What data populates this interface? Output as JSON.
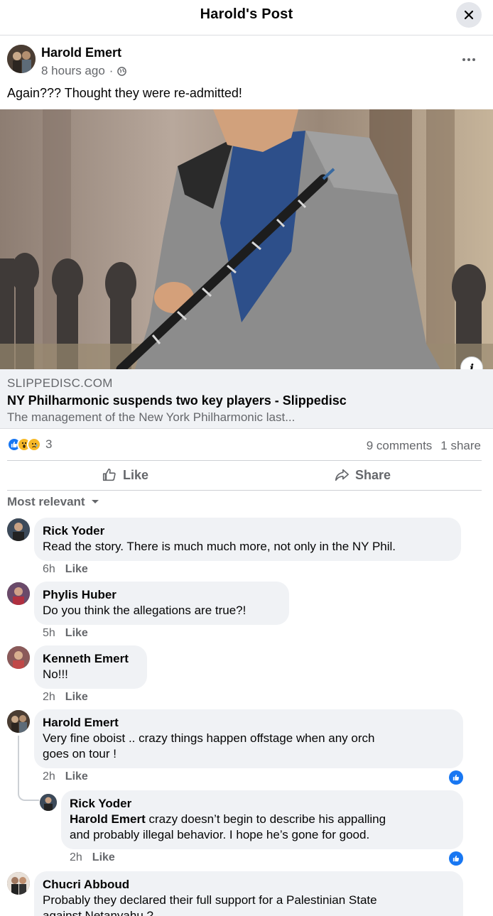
{
  "header": {
    "title": "Harold's Post"
  },
  "post": {
    "author": "Harold Emert",
    "time": "8 hours ago",
    "time_separator": "·",
    "text": "Again??? Thought they were re-admitted!"
  },
  "link_preview": {
    "domain": "SLIPPEDISC.COM",
    "title": "NY Philharmonic suspends two key players - Slippedisc",
    "description": "The management of the New York Philharmonic last..."
  },
  "reactions": {
    "count": "3",
    "types": [
      "like",
      "wow",
      "sad"
    ]
  },
  "stats": {
    "comments": "9 comments",
    "shares": "1 share"
  },
  "actions": {
    "like": "Like",
    "share": "Share"
  },
  "sort": {
    "label": "Most relevant"
  },
  "comments": [
    {
      "name": "Rick Yoder",
      "text": "Read the story. There is much much more, not only in the NY Phil.",
      "time": "6h",
      "like": "Like"
    },
    {
      "name": "Phylis Huber",
      "text": "Do you think the allegations are true?!",
      "time": "5h",
      "like": "Like"
    },
    {
      "name": "Kenneth Emert",
      "text": "No!!!",
      "time": "2h",
      "like": "Like"
    },
    {
      "name": "Harold Emert",
      "text_line1": "Very fine oboist .. crazy things happen offstage when any orch",
      "text_line2": "goes on tour !",
      "time": "2h",
      "like": "Like"
    },
    {
      "name": "Rick Yoder",
      "mention": "Harold Emert",
      "text_line1": " crazy doesn’t begin to describe his appalling",
      "text_line2": "and probably illegal behavior. I hope he’s gone for good.",
      "time": "2h",
      "like": "Like"
    },
    {
      "name": "Chucri Abboud",
      "text_line1": "Probably they declared their full support for a Palestinian State",
      "text_line2": "against Netanyahu ?"
    }
  ],
  "colors": {
    "facebook_blue": "#1877f2",
    "secondary_text": "#65676b",
    "bubble_bg": "#f0f2f5"
  }
}
